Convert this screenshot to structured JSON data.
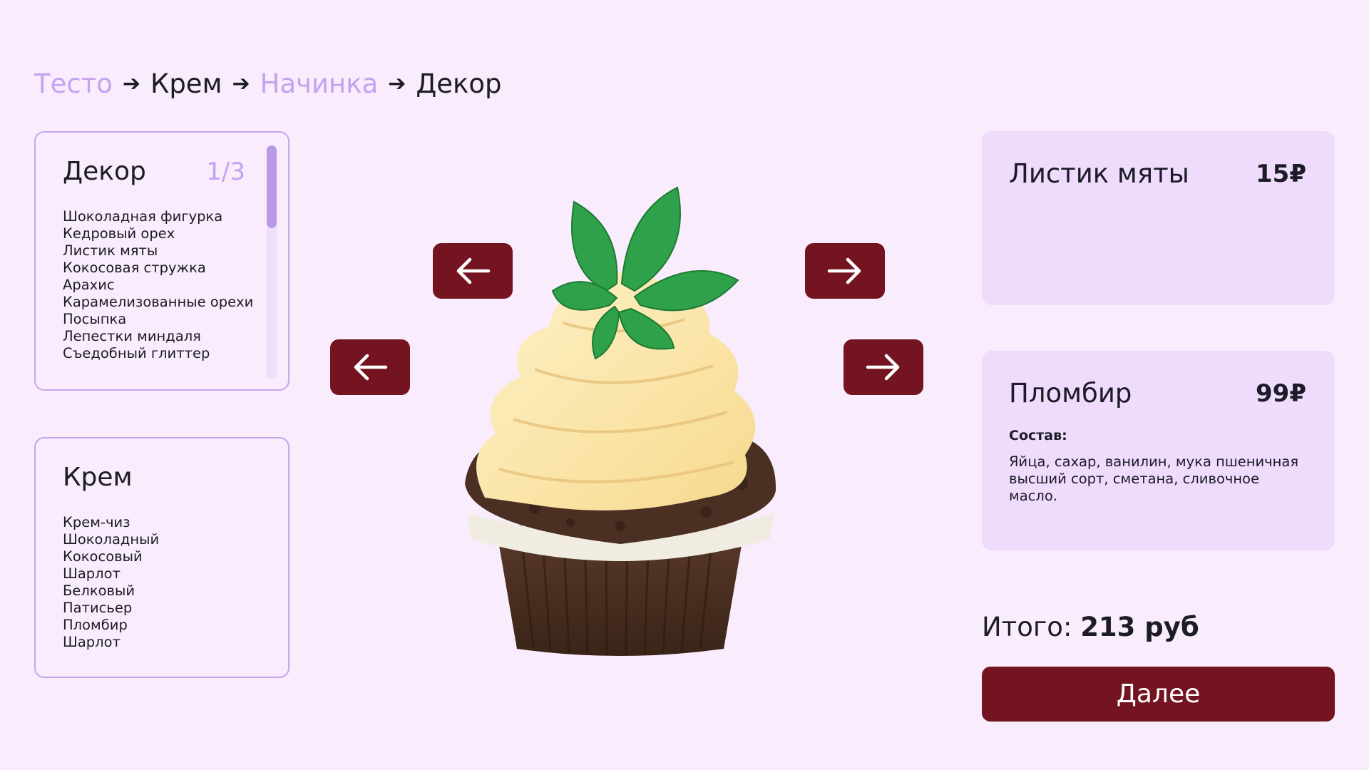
{
  "breadcrumb": [
    {
      "label": "Тесто",
      "state": "done"
    },
    {
      "label": "Крем",
      "state": "active"
    },
    {
      "label": "Начинка",
      "state": "done"
    },
    {
      "label": "Декор",
      "state": "active"
    }
  ],
  "decor_list": {
    "title": "Декор",
    "page": "1/3",
    "items": [
      "Шоколадная фигурка",
      "Кедровый орех",
      "Листик мяты",
      "Кокосовая стружка",
      "Арахис",
      "Карамелизованные орехи",
      "Посыпка",
      "Лепестки миндаля",
      "Съедобный глиттер"
    ]
  },
  "cream_list": {
    "title": "Крем",
    "items": [
      "Крем-чиз",
      "Шоколадный",
      "Кокосовый",
      "Шарлот",
      "Белковый",
      "Патисьер",
      "Пломбир",
      "Шарлот"
    ]
  },
  "selected_decor": {
    "title": "Листик мяты",
    "price": "15₽"
  },
  "selected_cream": {
    "title": "Пломбир",
    "price": "99₽",
    "composition_label": "Состав:",
    "composition": "Яйца, сахар, ванилин, мука пшеничная высший сорт, сметана, сливочное масло."
  },
  "total": {
    "label": "Итого:",
    "value": "213 руб"
  },
  "next_label": "Далее",
  "colors": {
    "accent": "#741421",
    "muted": "#c4a2f0",
    "background": "#f9ecfd",
    "card": "#efdbfc"
  },
  "icons": [
    "arrow-left-icon",
    "arrow-right-icon"
  ]
}
